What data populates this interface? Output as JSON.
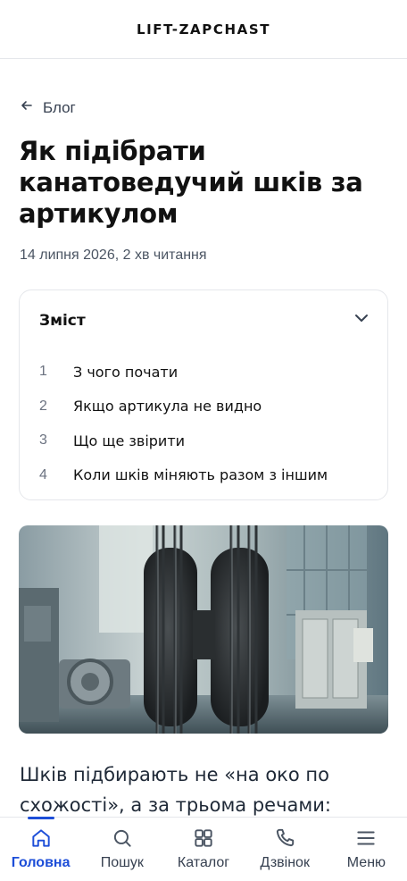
{
  "header": {
    "logo": "LIFT-ZAPCHAST"
  },
  "breadcrumb": {
    "back_label": "Блог"
  },
  "article": {
    "title": "Як підібрати канатоведучий шків за артикулом",
    "meta": "14 липня 2026, 2 хв читання",
    "intro": "Шків підбирають не «на око по схожості», а за трьома речами:"
  },
  "toc": {
    "title": "Зміст",
    "items": [
      {
        "num": "1",
        "label": "З чого почати"
      },
      {
        "num": "2",
        "label": "Якщо артикула не видно"
      },
      {
        "num": "3",
        "label": "Що ще звірити"
      },
      {
        "num": "4",
        "label": "Коли шків міняють разом з іншим"
      }
    ]
  },
  "tabbar": {
    "items": [
      {
        "label": "Головна",
        "icon": "home-icon",
        "active": true
      },
      {
        "label": "Пошук",
        "icon": "search-icon"
      },
      {
        "label": "Каталог",
        "icon": "grid-icon"
      },
      {
        "label": "Дзвінок",
        "icon": "phone-icon"
      },
      {
        "label": "Меню",
        "icon": "menu-icon"
      }
    ]
  },
  "colors": {
    "accent": "#1d4ed8",
    "text": "#111111",
    "muted": "#4b5563",
    "border": "#e5e7eb"
  }
}
